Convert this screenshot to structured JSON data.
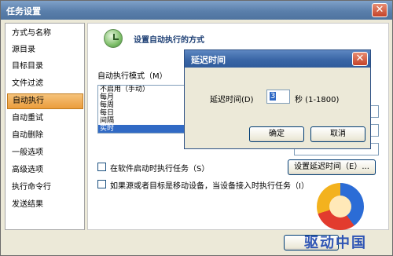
{
  "window": {
    "title": "任务设置"
  },
  "sidebar": {
    "items": [
      {
        "label": "方式与名称"
      },
      {
        "label": "源目录"
      },
      {
        "label": "目标目录"
      },
      {
        "label": "文件过滤"
      },
      {
        "label": "自动执行",
        "selected": true
      },
      {
        "label": "自动重试"
      },
      {
        "label": "自动删除"
      },
      {
        "label": "一般选项"
      },
      {
        "label": "高级选项"
      },
      {
        "label": "执行命令行"
      },
      {
        "label": "发送结果"
      }
    ]
  },
  "content": {
    "header_title": "设置自动执行的方式",
    "mode_label": "自动执行模式（M）",
    "modes": [
      {
        "label": "不启用（手动）"
      },
      {
        "label": "每月"
      },
      {
        "label": "每周"
      },
      {
        "label": "每日"
      },
      {
        "label": "间隔"
      },
      {
        "label": "实时",
        "selected": true
      }
    ],
    "check_startup": {
      "label": "在软件启动时执行任务（S）",
      "checked": false
    },
    "check_mobile": {
      "label": "如果源或者目标是移动设备，当设备接入时执行任务（I）",
      "checked": false
    },
    "delay_button": "设置延迟时间（E）..."
  },
  "dialog": {
    "title": "延迟时间",
    "delay_label": "延迟时间(D)",
    "delay_value": "3",
    "delay_unit": "秒 (1-1800)",
    "ok_button": "确定",
    "cancel_button": "取消"
  },
  "watermark": "驱动中国",
  "colors": {
    "accent": "#316ac5",
    "selected_nav": "#eb9d3c",
    "title_bar": "#5a7fab",
    "close": "#c4432a"
  }
}
